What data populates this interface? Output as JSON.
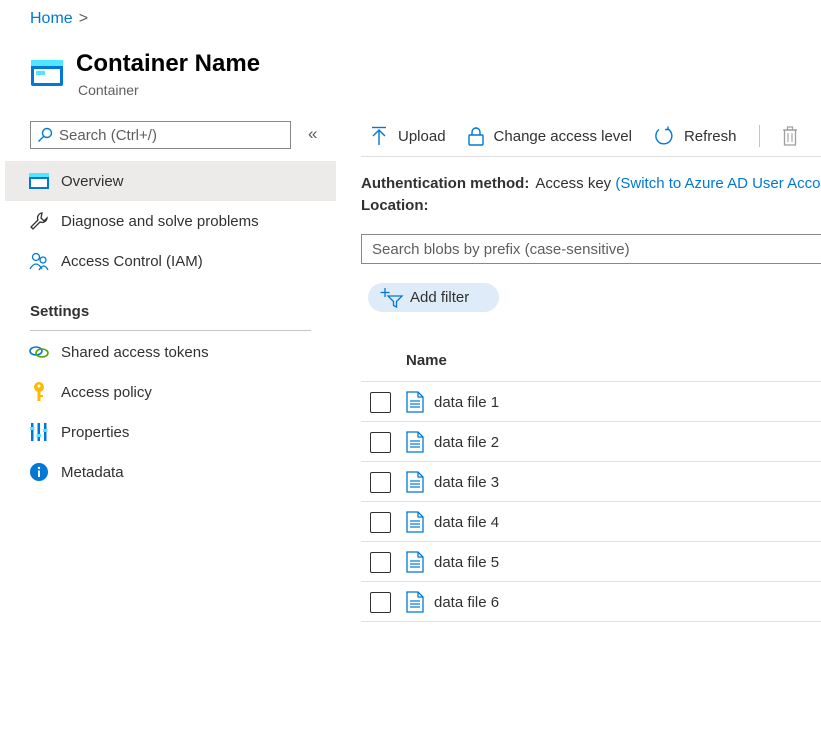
{
  "breadcrumb": {
    "home": "Home",
    "separator": ">"
  },
  "header": {
    "title": "Container Name",
    "subtitle": "Container",
    "icon": "container-icon"
  },
  "sidebar": {
    "search_placeholder": "Search (Ctrl+/)",
    "collapse_label": "«",
    "items": [
      {
        "label": "Overview",
        "icon": "overview-icon",
        "active": true
      },
      {
        "label": "Diagnose and solve problems",
        "icon": "wrench-icon"
      },
      {
        "label": "Access Control (IAM)",
        "icon": "people-icon"
      }
    ],
    "settings_label": "Settings",
    "settings_items": [
      {
        "label": "Shared access tokens",
        "icon": "link-icon"
      },
      {
        "label": "Access policy",
        "icon": "key-icon"
      },
      {
        "label": "Properties",
        "icon": "properties-icon"
      },
      {
        "label": "Metadata",
        "icon": "info-icon"
      }
    ]
  },
  "toolbar": {
    "upload": "Upload",
    "change_access": "Change access level",
    "refresh": "Refresh"
  },
  "info": {
    "auth_label": "Authentication method:",
    "auth_value": "Access key",
    "auth_link": "(Switch to Azure AD User Account)",
    "location_label": "Location:"
  },
  "blob_search_placeholder": "Search blobs by prefix (case-sensitive)",
  "add_filter": "Add filter",
  "table": {
    "column_name": "Name",
    "rows": [
      "data file 1",
      "data file 2",
      "data file 3",
      "data file 4",
      "data file 5",
      "data file 6"
    ]
  },
  "colors": {
    "accent": "#0078d4",
    "active_bg": "#edebe9",
    "pill_bg": "#deecf9"
  }
}
